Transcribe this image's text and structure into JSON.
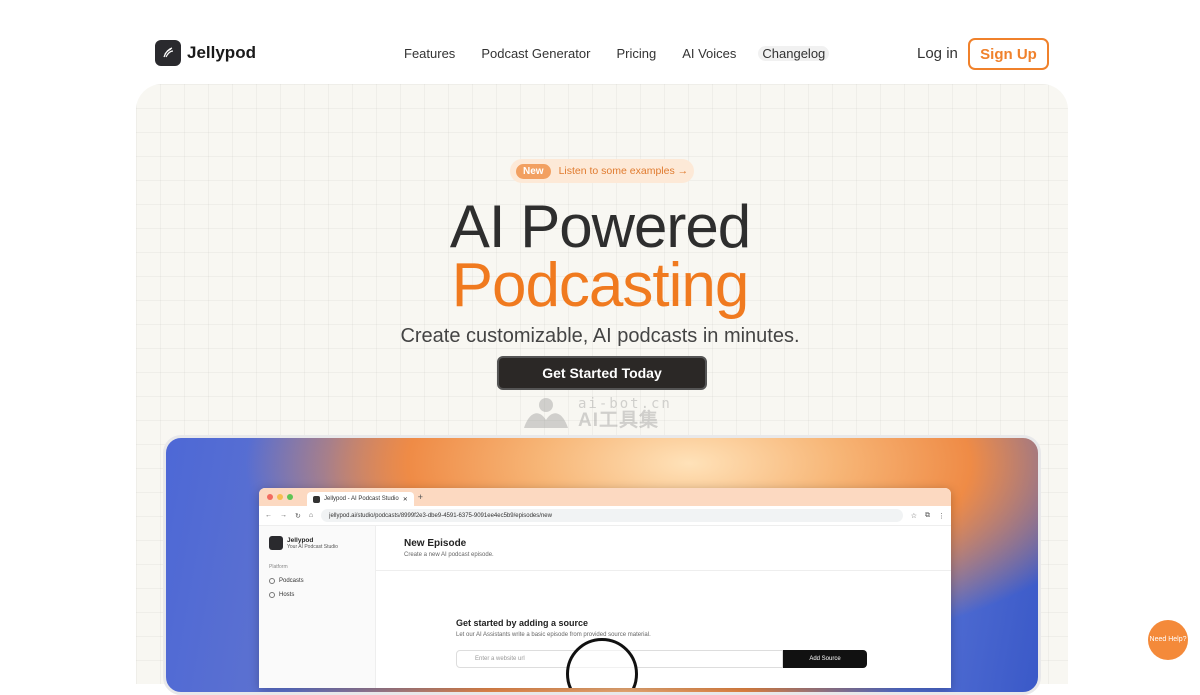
{
  "brand": {
    "name": "Jellypod"
  },
  "nav": {
    "links": [
      "Features",
      "Podcast Generator",
      "Pricing",
      "AI Voices",
      "Changelog"
    ],
    "login": "Log in",
    "signup": "Sign Up"
  },
  "hero": {
    "badge": "New",
    "badge_link": "Listen to some examples →",
    "title_line1": "AI Powered",
    "title_line2": "Podcasting",
    "subtitle": "Create customizable, AI podcasts in minutes.",
    "cta": "Get Started Today"
  },
  "watermark": {
    "line1": "ai-bot.cn",
    "line2": "AI工具集"
  },
  "preview": {
    "tab_title": "Jellypod - AI Podcast Studio",
    "url": "jellypod.ai/studio/podcasts/8999f2e3-dbe9-4591-6375-9091ee4ec5b9/episodes/new",
    "sidebar": {
      "title": "Jellypod",
      "subtitle": "Your AI Podcast Studio",
      "section": "Platform",
      "items": [
        "Podcasts",
        "Hosts"
      ]
    },
    "page_title": "New Episode",
    "page_subtitle": "Create a new AI podcast episode.",
    "source_title": "Get started by adding a source",
    "source_sub": "Let our AI Assistants write a basic episode from provided source material.",
    "input_placeholder": "Enter a website url",
    "add_source": "Add Source"
  },
  "help": "Need Help?",
  "colors": {
    "accent": "#f07a1f",
    "dark": "#2b2826"
  }
}
